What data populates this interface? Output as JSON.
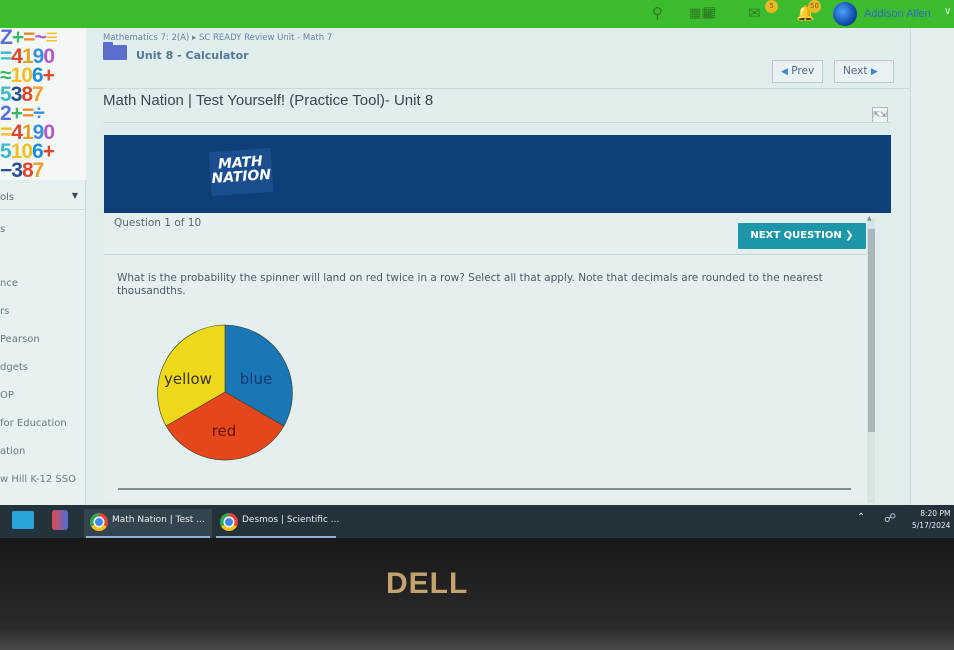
{
  "topbar": {
    "icons": [
      "search-icon",
      "apps-grid-icon",
      "calendar-icon",
      "mail-icon",
      "bell-icon"
    ],
    "mail_badge": "5",
    "notification_badge": "50",
    "user_name": "Addison Allen"
  },
  "sidebar": {
    "tools_label": "ols",
    "items": [
      "s",
      "nce",
      "rs",
      "Pearson",
      "dgets",
      "OP",
      "for Education",
      "ation",
      "w Hill K-12 SSO"
    ]
  },
  "breadcrumb": {
    "path": "Mathematics 7: 2(A) ▸ SC READY Review Unit - Math 7",
    "unit": "Unit 8 - Calculator"
  },
  "nav": {
    "prev_label": "Prev",
    "next_label": "Next"
  },
  "page": {
    "title": "Math Nation | Test Yourself! (Practice Tool)- Unit 8"
  },
  "banner": {
    "logo_line1": "MATH",
    "logo_line2": "NATION"
  },
  "question": {
    "counter": "Question 1 of 10",
    "next_button": "NEXT QUESTION ❯",
    "text": "What is the probability the spinner will land on red twice in a row? Select all that apply. Note that decimals are rounded to the nearest thousandths.",
    "spinner": {
      "sections": [
        {
          "label": "blue",
          "color": "#1a76b5",
          "text_color": "#0c3a73"
        },
        {
          "label": "red",
          "color": "#e4471c",
          "text_color": "#6a1308"
        },
        {
          "label": "yellow",
          "color": "#eed81c",
          "text_color": "#3a3410"
        }
      ]
    }
  },
  "taskbar": {
    "apps": [
      {
        "label": "Math Nation | Test ...",
        "icon": "chrome-icon"
      },
      {
        "label": "Desmos | Scientific ...",
        "icon": "chrome-icon"
      }
    ],
    "time": "8:20 PM",
    "date": "5/17/2024"
  },
  "bezel": {
    "brand": "DELL"
  }
}
